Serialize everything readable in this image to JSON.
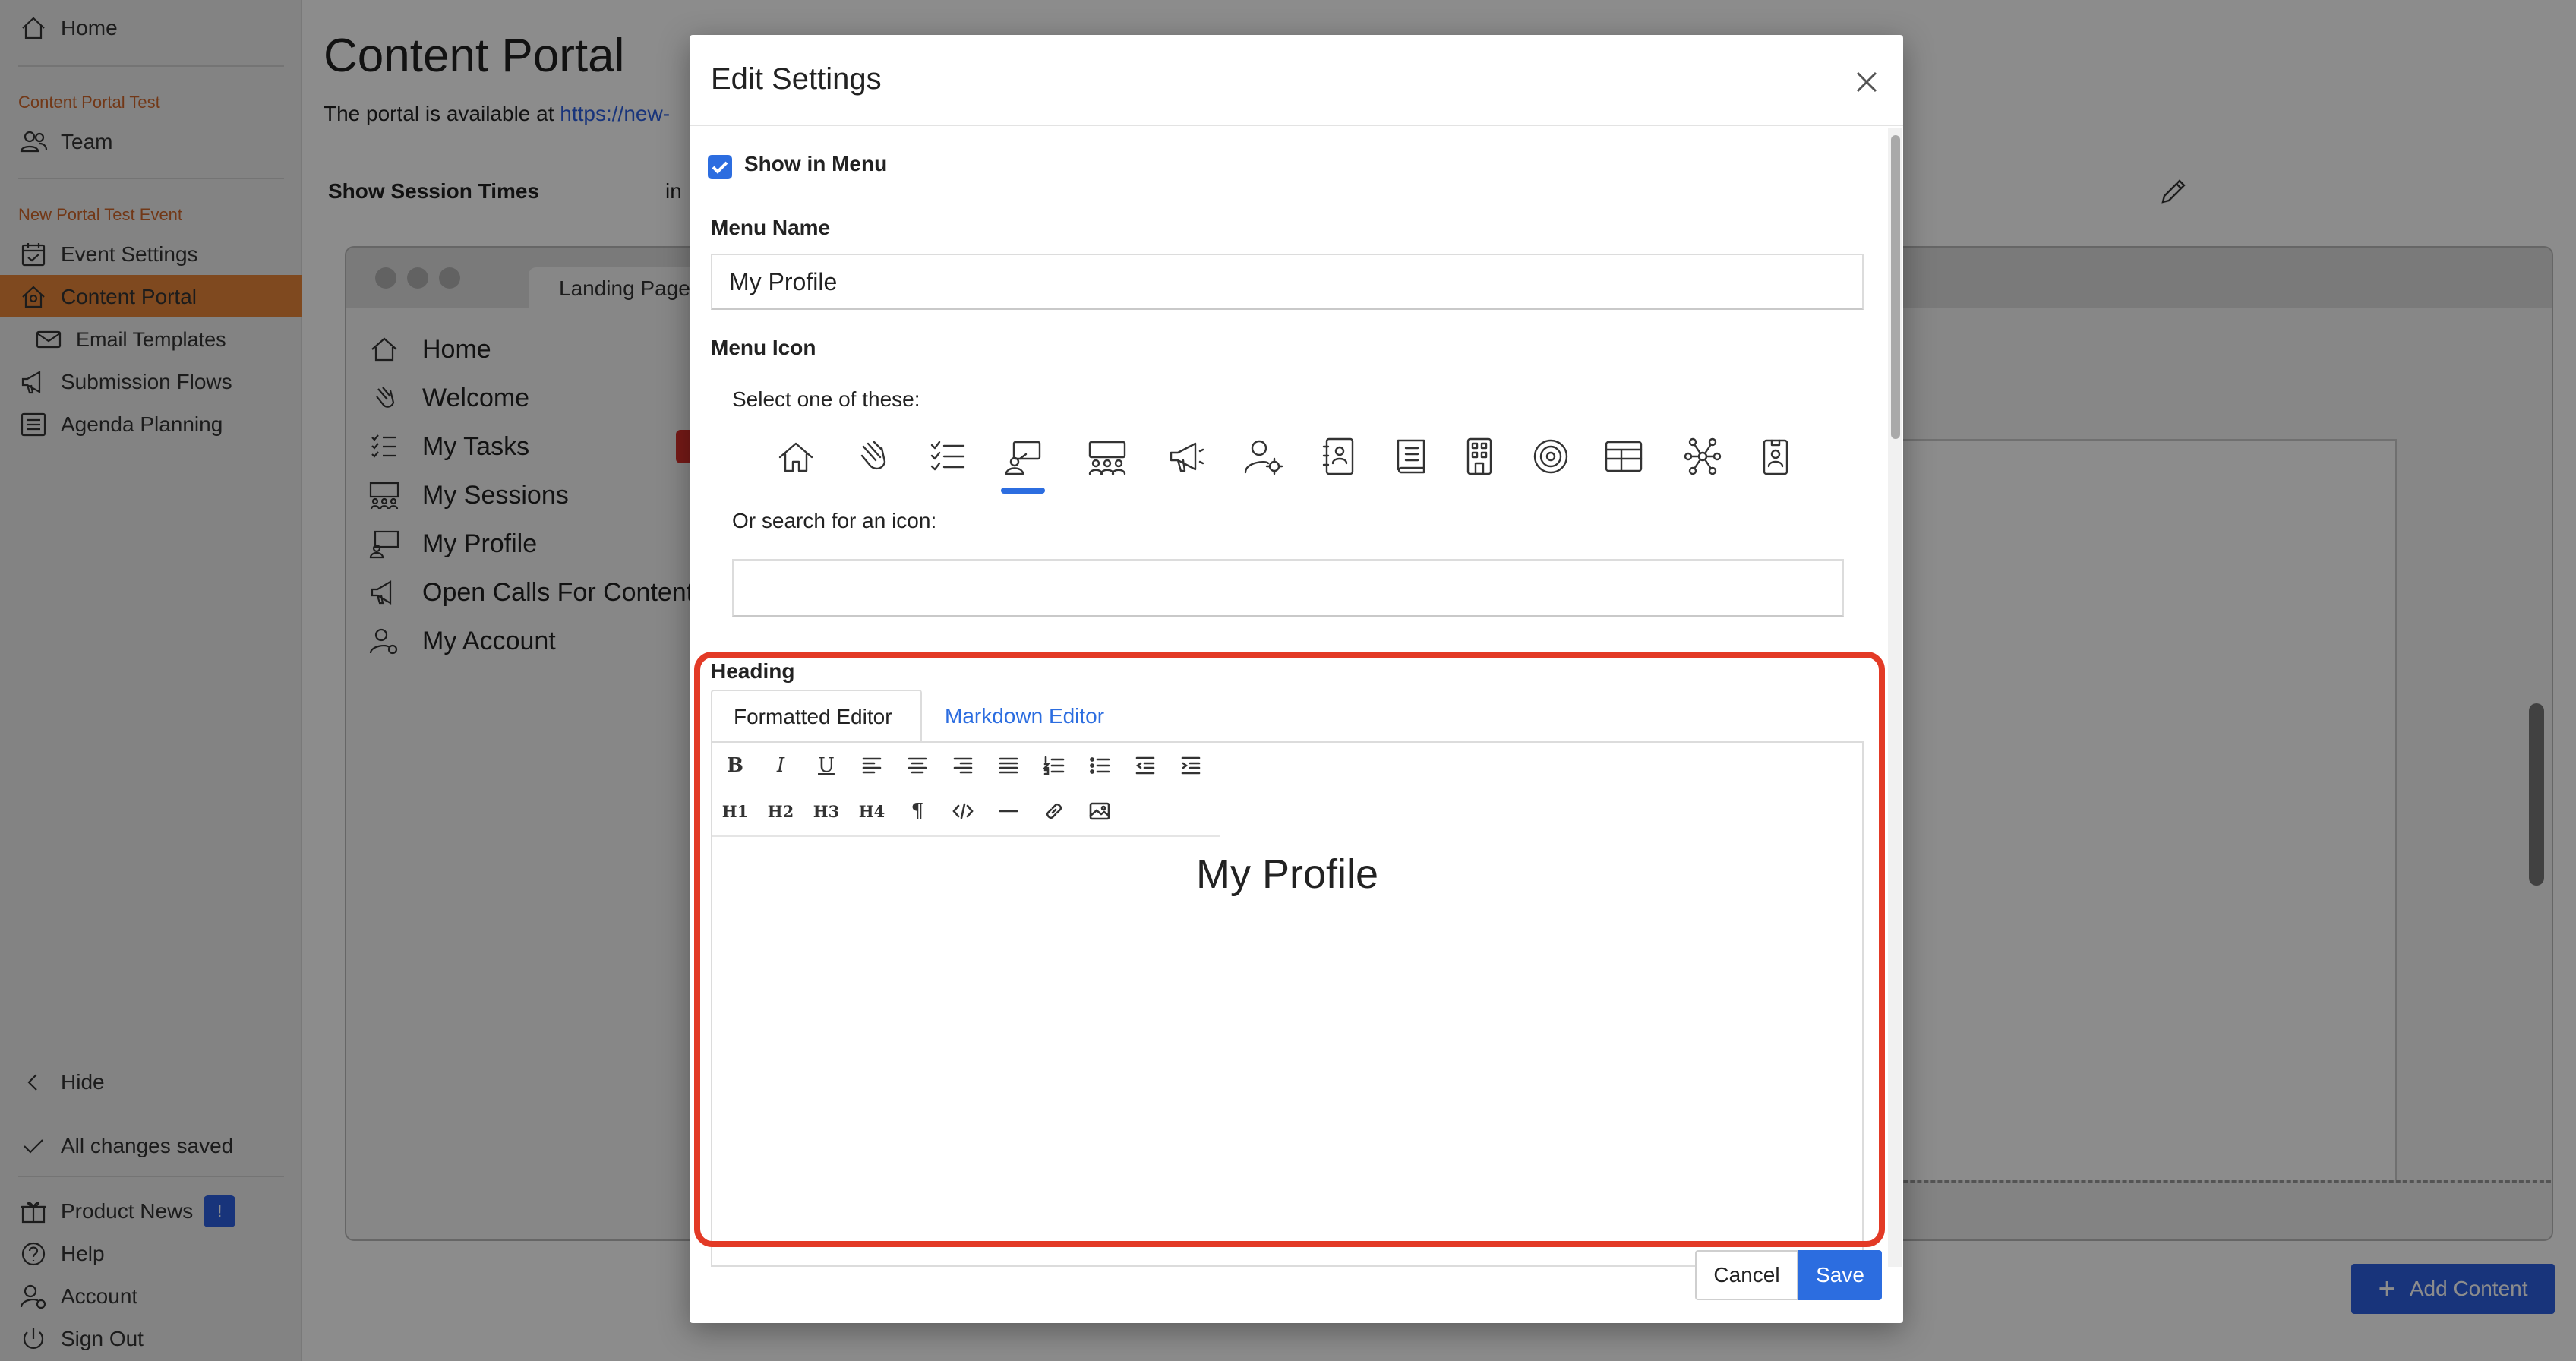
{
  "colors": {
    "accent": "#2c6de0",
    "sidebar_active": "#e8863a",
    "highlight_box": "#e33a26"
  },
  "sidebar": {
    "home": "Home",
    "section1": "Content Portal Test",
    "team": "Team",
    "section2": "New Portal Test Event",
    "items": [
      {
        "label": "Event Settings",
        "icon": "calendar-icon"
      },
      {
        "label": "Content Portal",
        "icon": "portal-home-icon"
      },
      {
        "label": "Email Templates",
        "icon": "envelope-icon"
      },
      {
        "label": "Submission Flows",
        "icon": "megaphone-icon"
      },
      {
        "label": "Agenda Planning",
        "icon": "list-icon"
      }
    ],
    "hide": "Hide",
    "saved": "All changes saved",
    "product_news": "Product News",
    "product_news_badge": "!",
    "help": "Help",
    "account": "Account",
    "sign_out": "Sign Out"
  },
  "main": {
    "title": "Content Portal",
    "subtitle_prefix": "The portal is available at",
    "subtitle_link": "https://new-",
    "show_session_times": "Show Session Times",
    "sst_in": "in",
    "preview_tab": "Landing Page",
    "preview_menu": [
      "Home",
      "Welcome",
      "My Tasks",
      "My Sessions",
      "My Profile",
      "Open Calls For Content",
      "My Account"
    ],
    "add_content": "Add Content"
  },
  "modal": {
    "title": "Edit Settings",
    "show_in_menu": "Show in Menu",
    "show_in_menu_checked": true,
    "menu_name_label": "Menu Name",
    "menu_name_value": "My Profile",
    "menu_icon_label": "Menu Icon",
    "select_label": "Select one of these:",
    "icons": [
      "home-icon",
      "wave-hand-icon",
      "checklist-icon",
      "profile-presenter-icon",
      "group-icon",
      "megaphone-icon",
      "user-gear-icon",
      "contact-book-icon",
      "book-icon",
      "building-icon",
      "target-icon",
      "table-icon",
      "network-icon",
      "badge-icon"
    ],
    "selected_icon": "profile-presenter-icon",
    "search_label": "Or search for an icon:",
    "search_value": "",
    "heading_label": "Heading",
    "tab_formatted": "Formatted Editor",
    "tab_markdown": "Markdown Editor",
    "toolbar_row2": [
      "H1",
      "H2",
      "H3",
      "H4"
    ],
    "editor_content": "My Profile",
    "cancel": "Cancel",
    "save": "Save"
  }
}
